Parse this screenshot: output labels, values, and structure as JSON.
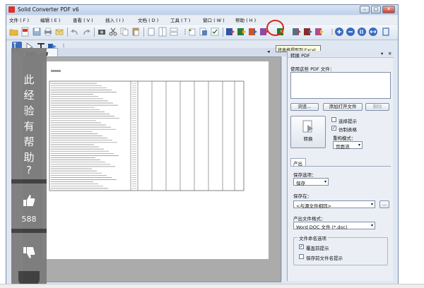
{
  "window": {
    "title": "Solid Converter PDF v6",
    "controls": [
      "–",
      "□",
      "✕"
    ]
  },
  "menu": [
    "文件 ( F )",
    "编辑 ( E )",
    "查看 ( V )",
    "插入 ( I )",
    "文档 ( D )",
    "工具 ( T )",
    "窗口 ( W )",
    "帮助 ( H )"
  ],
  "toolbar": {
    "highlighted_tooltip": "将表格提取到 Excel"
  },
  "document_tab": {
    "label": "抗表1.pdf",
    "controls": [
      "◂",
      "✕"
    ]
  },
  "panel": {
    "header": "转换 PDF",
    "header_controls": [
      "▾",
      "✕"
    ],
    "use_pdf_label": "使用这些 PDF 文件：",
    "browse_button": "浏览...",
    "add_open_button": "添加打开文件",
    "delete_button": "删除",
    "convert_button": "转换",
    "check_prompt": "选择提示",
    "check_tables": "仿制表格",
    "reconstruct_label": "重构模式：",
    "reconstruct_value": "页面流",
    "output_tab": "产出",
    "save_options_label": "保存选项：",
    "save_options_value": "保存",
    "save_in_label": "保存在：",
    "save_in_value": "<与源文件相同>",
    "browse_small": "...",
    "format_label": "产出文件格式：",
    "format_value": "Word DOC 文件 (*.doc)",
    "naming_label": "文件命名选项",
    "overwrite_prompt": "覆盖前提示",
    "save_before_prompt": "保存前文件名提示",
    "check_prompt_checked": false,
    "check_tables_checked": true,
    "overwrite_checked": true,
    "save_before_checked": false
  },
  "overlay": {
    "chars": [
      "此",
      "经",
      "验",
      "有",
      "帮",
      "助",
      "?"
    ],
    "like_count": "588",
    "like_icon": "thumbs-up-icon",
    "dislike_icon": "thumbs-down-icon"
  }
}
